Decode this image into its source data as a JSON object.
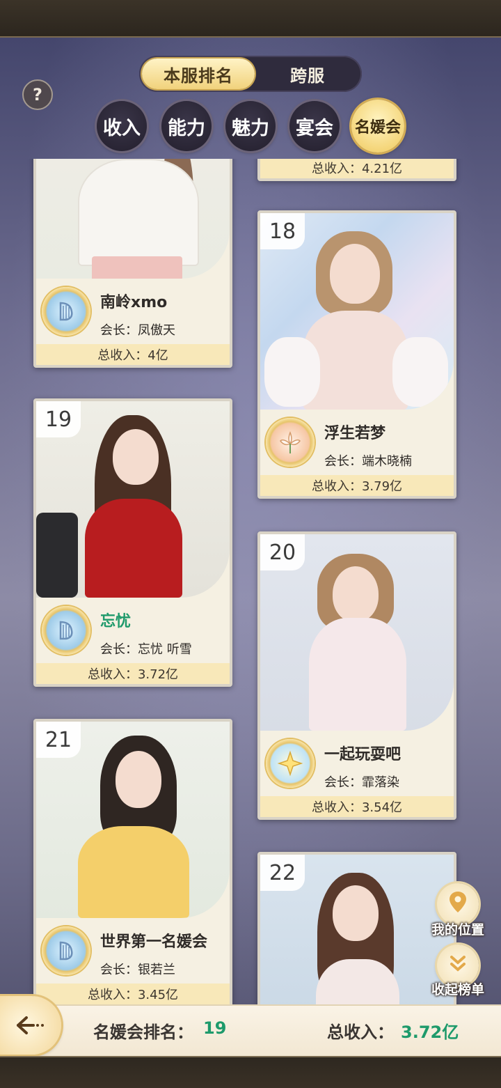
{
  "tabs": {
    "scope": [
      {
        "label": "本服排名",
        "active": true
      },
      {
        "label": "跨服",
        "active": false
      }
    ],
    "help_label": "?",
    "categories": [
      {
        "label": "收入",
        "active": false
      },
      {
        "label": "能力",
        "active": false
      },
      {
        "label": "魅力",
        "active": false
      },
      {
        "label": "宴会",
        "active": false
      },
      {
        "label": "名媛会",
        "active": true
      }
    ]
  },
  "cards": [
    {
      "rank": "",
      "name": "",
      "leader": "",
      "income": "总收入：4.21亿",
      "emblem": "harp-emblem-icon"
    },
    {
      "rank": "",
      "name": "南岭xmo",
      "leader": "会长：凤傲天",
      "income": "总收入：4亿",
      "emblem": "harp-emblem-icon"
    },
    {
      "rank": "18",
      "name": "浮生若梦",
      "leader": "会长：端木晓楠",
      "income": "总收入：3.79亿",
      "emblem": "lily-emblem-icon"
    },
    {
      "rank": "19",
      "name": "忘忧",
      "leader": "会长：忘忧 听雪",
      "income": "总收入：3.72亿",
      "emblem": "harp-emblem-icon",
      "highlight": true
    },
    {
      "rank": "20",
      "name": "一起玩耍吧",
      "leader": "会长：霏落染",
      "income": "总收入：3.54亿",
      "emblem": "star-emblem-icon"
    },
    {
      "rank": "21",
      "name": "世界第一名媛会",
      "leader": "会长：银若兰",
      "income": "总收入：3.45亿",
      "emblem": "harp-emblem-icon"
    },
    {
      "rank": "22",
      "name": "",
      "leader": "",
      "income": "",
      "emblem": ""
    }
  ],
  "side_buttons": {
    "my_position": "我的位置",
    "collapse": "收起榜单"
  },
  "bottom_bar": {
    "rank_label": "名媛会排名：",
    "rank_value": "19",
    "income_label": "总收入：",
    "income_value": "3.72亿"
  },
  "colors": {
    "accent_gold": "#f1d27c",
    "highlight_green": "#1e9a6b",
    "card_bg": "#f5f0e2",
    "income_strip": "#f8e8b9"
  }
}
